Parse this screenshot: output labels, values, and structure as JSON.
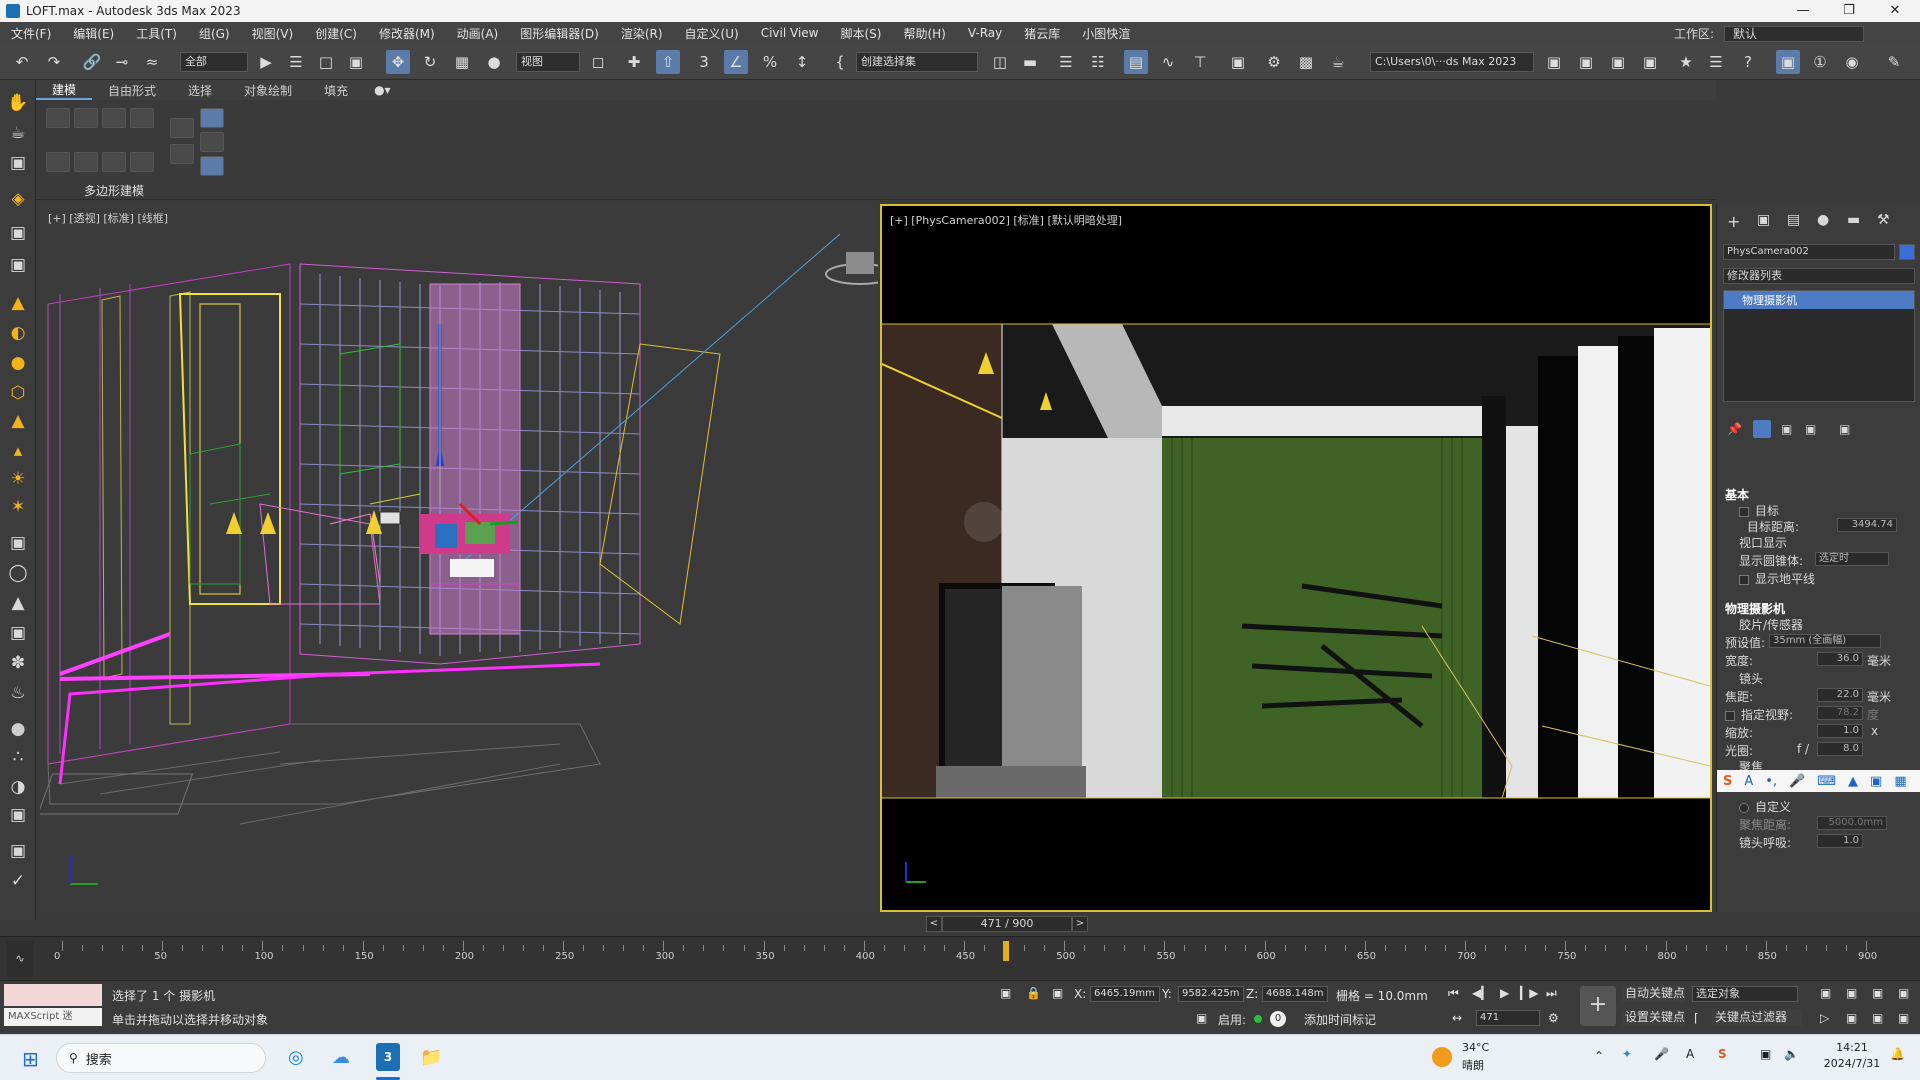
{
  "window": {
    "title": "LOFT.max - Autodesk 3ds Max 2023"
  },
  "menu": {
    "items": [
      "文件(F)",
      "编辑(E)",
      "工具(T)",
      "组(G)",
      "视图(V)",
      "创建(C)",
      "修改器(M)",
      "动画(A)",
      "图形编辑器(D)",
      "渲染(R)",
      "自定义(U)",
      "Civil View",
      "脚本(S)",
      "帮助(H)",
      "V-Ray",
      "猪云库",
      "小图快渲"
    ],
    "workspace_label": "工作区:",
    "workspace_value": "默认"
  },
  "toolbar": {
    "filter": "全部",
    "coord": "视图",
    "selection_set": "创建选择集",
    "path": "C:\\Users\\0\\···ds Max 2023"
  },
  "ribbon": {
    "tabs": [
      "建模",
      "自由形式",
      "选择",
      "对象绘制",
      "填充"
    ],
    "group_label": "多边形建模"
  },
  "viewports": {
    "left_label": "[+] [透视] [标准] [线框]",
    "right_label": "[+] [PhysCamera002] [标准] [默认明暗处理]"
  },
  "command_panel": {
    "object_name": "PhysCamera002",
    "modifier_list": "修改器列表",
    "stack_item": "物理摄影机",
    "basic_header": "基本",
    "target": "目标",
    "target_distance_label": "目标距离:",
    "target_distance": "3494.74",
    "viewport_display": "视口显示",
    "show_cone_label": "显示圆锥体:",
    "show_cone_value": "选定时",
    "show_horizon": "显示地平线",
    "physcam_header": "物理摄影机",
    "film_sensor": "胶片/传感器",
    "preset_label": "预设值:",
    "preset_value": "35mm (全画幅)",
    "width_label": "宽度:",
    "width_value": "36.0",
    "width_unit": "毫米",
    "lens": "镜头",
    "focal_label": "焦距:",
    "focal_value": "22.0",
    "focal_unit": "毫米",
    "fov_label": "指定视野:",
    "fov_value": "78.2",
    "fov_unit": "度",
    "zoom_label": "缩放:",
    "zoom_value": "1.0",
    "zoom_unit": "x",
    "aperture_label": "光圈:",
    "aperture_prefix": "f /",
    "aperture_value": "8.0",
    "focus": "聚焦",
    "custom": "自定义",
    "focus_dist_label": "聚焦距离:",
    "focus_dist_value": "5000.0mm",
    "lens_breathing_label": "镜头呼吸:",
    "lens_breathing_value": "1.0"
  },
  "timeline": {
    "frame_display": "471 / 900",
    "current_frame": 471,
    "total_frames": 900,
    "ticks": [
      "0",
      "50",
      "100",
      "150",
      "200",
      "250",
      "300",
      "350",
      "400",
      "450",
      "500",
      "550",
      "600",
      "650",
      "700",
      "750",
      "800",
      "850",
      "900"
    ]
  },
  "status": {
    "script_label": "MAXScript 迷",
    "selected": "选择了 1 个 摄影机",
    "hint": "单击并拖动以选择并移动对象",
    "x_label": "X:",
    "x": "6465.19mm",
    "y_label": "Y:",
    "y": "9582.425m",
    "z_label": "Z:",
    "z": "4688.148m",
    "grid": "栅格 = 10.0mm",
    "enable": "启用:",
    "add_time_tag": "添加时间标记",
    "auto_key": "自动关键点",
    "set_key": "设置关键点",
    "select_object": "选定对象",
    "key_filter": "关键点过滤器",
    "frame_field": "471"
  },
  "taskbar": {
    "search": "搜索",
    "weather_temp": "34°C",
    "weather_desc": "晴朗",
    "time": "14:21",
    "date": "2024/7/31"
  }
}
